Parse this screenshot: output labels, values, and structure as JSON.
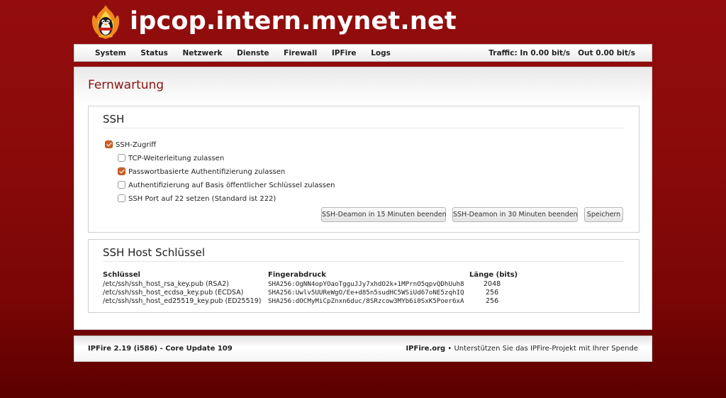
{
  "header": {
    "hostname": "ipcop.intern.mynet.net",
    "logo_icon": "ipfire-penguin-flame-logo"
  },
  "nav": {
    "items": [
      "System",
      "Status",
      "Netzwerk",
      "Dienste",
      "Firewall",
      "IPFire",
      "Logs"
    ],
    "traffic": "Traffic: In 0.00 bit/s   Out 0.00 bit/s"
  },
  "page": {
    "title": "Fernwartung"
  },
  "ssh": {
    "title": "SSH",
    "options": [
      {
        "label": "SSH-Zugriff",
        "checked": true
      },
      {
        "label": "TCP-Weiterleitung zulassen",
        "checked": false
      },
      {
        "label": "Passwortbasierte Authentifizierung zulassen",
        "checked": true
      },
      {
        "label": "Authentifizierung auf Basis öffentlicher Schlüssel zulassen",
        "checked": false
      },
      {
        "label": "SSH Port auf 22 setzen (Standard ist 222)",
        "checked": false
      }
    ],
    "buttons": {
      "stop15": "SSH-Deamon in 15 Minuten beenden",
      "stop30": "SSH-Deamon in 30 Minuten beenden",
      "save": "Speichern"
    }
  },
  "hostkeys": {
    "title": "SSH Host Schlüssel",
    "headers": [
      "Schlüssel",
      "Fingerabdruck",
      "Länge (bits)"
    ],
    "rows": [
      {
        "key": "/etc/ssh/ssh_host_rsa_key.pub (RSA2)",
        "fingerprint": "SHA256:OgNN4opYOaoTgguJJy7xhdO2k+1MPrnO5qpvQDhUuh8",
        "length": "2048"
      },
      {
        "key": "/etc/ssh/ssh_host_ecdsa_key.pub (ECDSA)",
        "fingerprint": "SHA256:Uwlv5UUReWgO/Ee+d85n5sudHC5WSiUd67oNE5zqhIQ",
        "length": "256"
      },
      {
        "key": "/etc/ssh/ssh_host_ed25519_key.pub (ED25519)",
        "fingerprint": "SHA256:dOCMyMiCpZnxn6duc/8SRzcow3MYb6i0SxK5Poer6xA",
        "length": "256"
      }
    ]
  },
  "footer": {
    "version": "IPFire 2.19 (i586) - Core Update 109",
    "site": "IPFire.org",
    "support_text": " • Unterstützen Sie das IPFire-Projekt mit Ihrer Spende"
  }
}
